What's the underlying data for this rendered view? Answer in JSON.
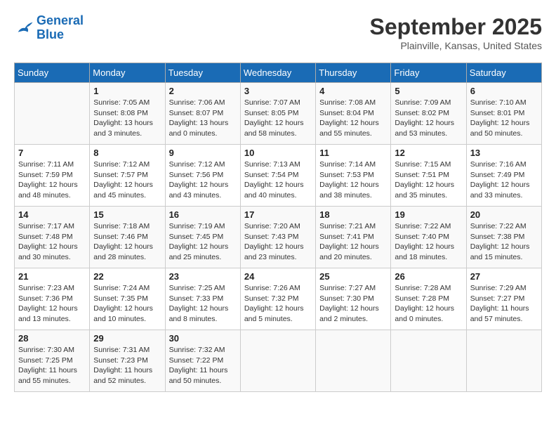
{
  "logo": {
    "line1": "General",
    "line2": "Blue"
  },
  "title": "September 2025",
  "location": "Plainville, Kansas, United States",
  "weekdays": [
    "Sunday",
    "Monday",
    "Tuesday",
    "Wednesday",
    "Thursday",
    "Friday",
    "Saturday"
  ],
  "weeks": [
    [
      null,
      {
        "day": "1",
        "sunrise": "7:05 AM",
        "sunset": "8:08 PM",
        "daylight": "13 hours and 3 minutes."
      },
      {
        "day": "2",
        "sunrise": "7:06 AM",
        "sunset": "8:07 PM",
        "daylight": "13 hours and 0 minutes."
      },
      {
        "day": "3",
        "sunrise": "7:07 AM",
        "sunset": "8:05 PM",
        "daylight": "12 hours and 58 minutes."
      },
      {
        "day": "4",
        "sunrise": "7:08 AM",
        "sunset": "8:04 PM",
        "daylight": "12 hours and 55 minutes."
      },
      {
        "day": "5",
        "sunrise": "7:09 AM",
        "sunset": "8:02 PM",
        "daylight": "12 hours and 53 minutes."
      },
      {
        "day": "6",
        "sunrise": "7:10 AM",
        "sunset": "8:01 PM",
        "daylight": "12 hours and 50 minutes."
      }
    ],
    [
      {
        "day": "7",
        "sunrise": "7:11 AM",
        "sunset": "7:59 PM",
        "daylight": "12 hours and 48 minutes."
      },
      {
        "day": "8",
        "sunrise": "7:12 AM",
        "sunset": "7:57 PM",
        "daylight": "12 hours and 45 minutes."
      },
      {
        "day": "9",
        "sunrise": "7:12 AM",
        "sunset": "7:56 PM",
        "daylight": "12 hours and 43 minutes."
      },
      {
        "day": "10",
        "sunrise": "7:13 AM",
        "sunset": "7:54 PM",
        "daylight": "12 hours and 40 minutes."
      },
      {
        "day": "11",
        "sunrise": "7:14 AM",
        "sunset": "7:53 PM",
        "daylight": "12 hours and 38 minutes."
      },
      {
        "day": "12",
        "sunrise": "7:15 AM",
        "sunset": "7:51 PM",
        "daylight": "12 hours and 35 minutes."
      },
      {
        "day": "13",
        "sunrise": "7:16 AM",
        "sunset": "7:49 PM",
        "daylight": "12 hours and 33 minutes."
      }
    ],
    [
      {
        "day": "14",
        "sunrise": "7:17 AM",
        "sunset": "7:48 PM",
        "daylight": "12 hours and 30 minutes."
      },
      {
        "day": "15",
        "sunrise": "7:18 AM",
        "sunset": "7:46 PM",
        "daylight": "12 hours and 28 minutes."
      },
      {
        "day": "16",
        "sunrise": "7:19 AM",
        "sunset": "7:45 PM",
        "daylight": "12 hours and 25 minutes."
      },
      {
        "day": "17",
        "sunrise": "7:20 AM",
        "sunset": "7:43 PM",
        "daylight": "12 hours and 23 minutes."
      },
      {
        "day": "18",
        "sunrise": "7:21 AM",
        "sunset": "7:41 PM",
        "daylight": "12 hours and 20 minutes."
      },
      {
        "day": "19",
        "sunrise": "7:22 AM",
        "sunset": "7:40 PM",
        "daylight": "12 hours and 18 minutes."
      },
      {
        "day": "20",
        "sunrise": "7:22 AM",
        "sunset": "7:38 PM",
        "daylight": "12 hours and 15 minutes."
      }
    ],
    [
      {
        "day": "21",
        "sunrise": "7:23 AM",
        "sunset": "7:36 PM",
        "daylight": "12 hours and 13 minutes."
      },
      {
        "day": "22",
        "sunrise": "7:24 AM",
        "sunset": "7:35 PM",
        "daylight": "12 hours and 10 minutes."
      },
      {
        "day": "23",
        "sunrise": "7:25 AM",
        "sunset": "7:33 PM",
        "daylight": "12 hours and 8 minutes."
      },
      {
        "day": "24",
        "sunrise": "7:26 AM",
        "sunset": "7:32 PM",
        "daylight": "12 hours and 5 minutes."
      },
      {
        "day": "25",
        "sunrise": "7:27 AM",
        "sunset": "7:30 PM",
        "daylight": "12 hours and 2 minutes."
      },
      {
        "day": "26",
        "sunrise": "7:28 AM",
        "sunset": "7:28 PM",
        "daylight": "12 hours and 0 minutes."
      },
      {
        "day": "27",
        "sunrise": "7:29 AM",
        "sunset": "7:27 PM",
        "daylight": "11 hours and 57 minutes."
      }
    ],
    [
      {
        "day": "28",
        "sunrise": "7:30 AM",
        "sunset": "7:25 PM",
        "daylight": "11 hours and 55 minutes."
      },
      {
        "day": "29",
        "sunrise": "7:31 AM",
        "sunset": "7:23 PM",
        "daylight": "11 hours and 52 minutes."
      },
      {
        "day": "30",
        "sunrise": "7:32 AM",
        "sunset": "7:22 PM",
        "daylight": "11 hours and 50 minutes."
      },
      null,
      null,
      null,
      null
    ]
  ],
  "labels": {
    "sunrise_prefix": "Sunrise: ",
    "sunset_prefix": "Sunset: ",
    "daylight_prefix": "Daylight: "
  }
}
